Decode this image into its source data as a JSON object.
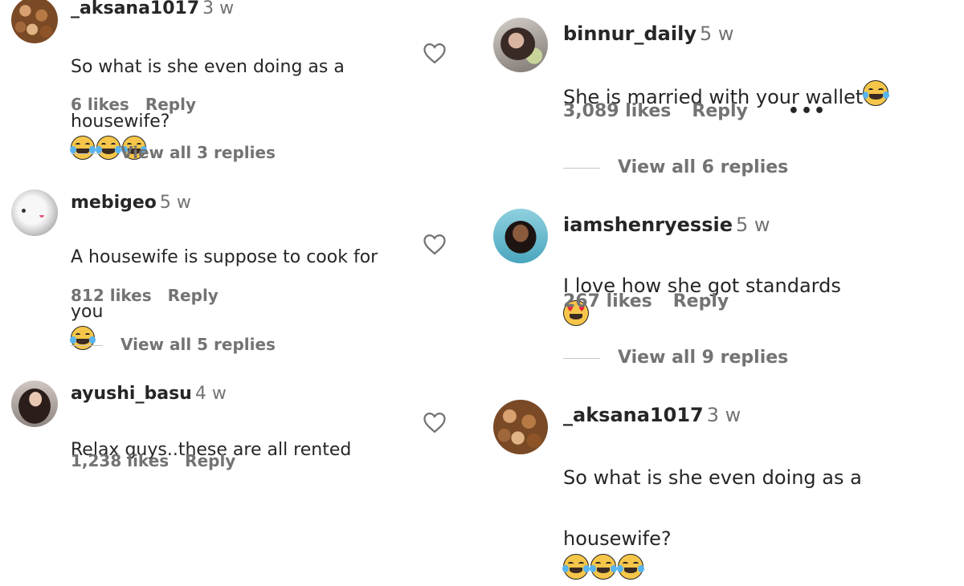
{
  "left_column": {
    "comments": [
      {
        "username": "_aksana1017",
        "time": "3 w",
        "text_line1": "So what is she even doing as a",
        "text_line2": "housewife?",
        "likes": "6 likes",
        "reply": "Reply",
        "view_replies": "View all 3 replies",
        "avatar_icon": "food-avatar-icon"
      },
      {
        "username": "mebigeo",
        "time": "5 w",
        "text_line1": "A housewife is suppose to cook for",
        "text_line2": "you",
        "likes": "812 likes",
        "reply": "Reply",
        "view_replies": "View all 5 replies",
        "avatar_icon": "ghost-avatar-icon"
      },
      {
        "username": "ayushi_basu",
        "time": "4 w",
        "text_line1": "Relax guys..these are all rented",
        "likes": "1,238 likes",
        "reply": "Reply",
        "avatar_icon": "girl-avatar-icon"
      }
    ]
  },
  "right_column": {
    "comments": [
      {
        "username": "binnur_daily",
        "time": "5 w",
        "text_line1": "She is married with your wallet",
        "likes": "3,089 likes",
        "reply": "Reply",
        "more": "•••",
        "view_replies": "View all 6 replies",
        "avatar_icon": "selfie-avatar-icon"
      },
      {
        "username": "iamshenryessie",
        "time": "5 w",
        "text_line1": "I love how she got standards",
        "likes": "267 likes",
        "reply": "Reply",
        "view_replies": "View all 9 replies",
        "avatar_icon": "woman-avatar-icon"
      },
      {
        "username": "_aksana1017",
        "time": "3 w",
        "text_line1": "So what is she even doing as a",
        "text_line2": "housewife?",
        "avatar_icon": "food-avatar-icon"
      }
    ]
  },
  "icons": {
    "like": "heart-outline-icon",
    "laugh_emoji": "face-with-tears-of-joy-emoji",
    "heart_eyes_emoji": "smiling-face-with-heart-eyes-emoji"
  },
  "colors": {
    "text": "#262626",
    "secondary": "#737373",
    "emoji_yellow": "#f6c64a"
  }
}
